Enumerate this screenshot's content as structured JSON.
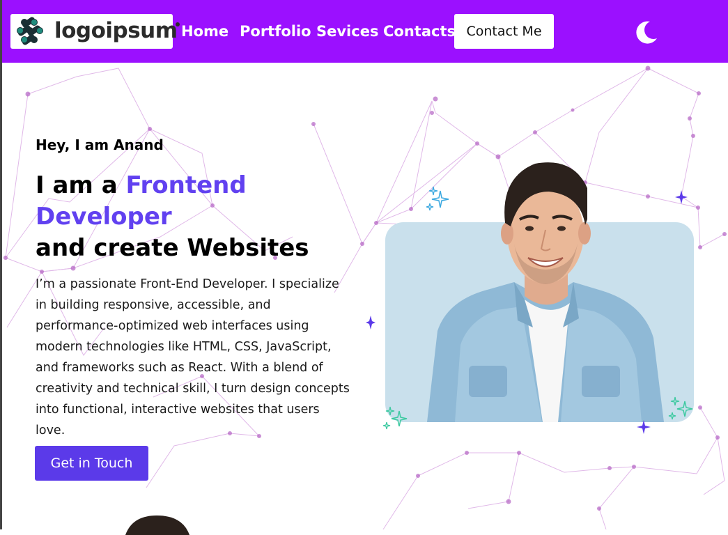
{
  "header": {
    "logo_text": "logoipsum",
    "nav": [
      {
        "label": "Home"
      },
      {
        "label": "Portfolio"
      },
      {
        "label": "Sevices"
      },
      {
        "label": "Contacts"
      }
    ],
    "contact_button": "Contact Me",
    "theme_toggle_icon": "moon-icon"
  },
  "hero": {
    "greeting": "Hey, I am Anand",
    "headline_prefix": "I am a ",
    "headline_accent": "Frontend Developer",
    "headline_suffix": "and create Websites",
    "bio": "I’m a passionate Front-End Developer. I specialize in building responsive, accessible, and performance-optimized web interfaces using modern technologies like HTML, CSS, JavaScript, and frameworks such as React. With a blend of creativity and technical skill, I turn design concepts into functional, interactive websites that users love.",
    "cta_label": "Get in Touch"
  },
  "colors": {
    "navbar": "#9b10ff",
    "accent": "#6141f0",
    "button": "#5b3ae9",
    "image_bg": "#c9e0ec"
  }
}
